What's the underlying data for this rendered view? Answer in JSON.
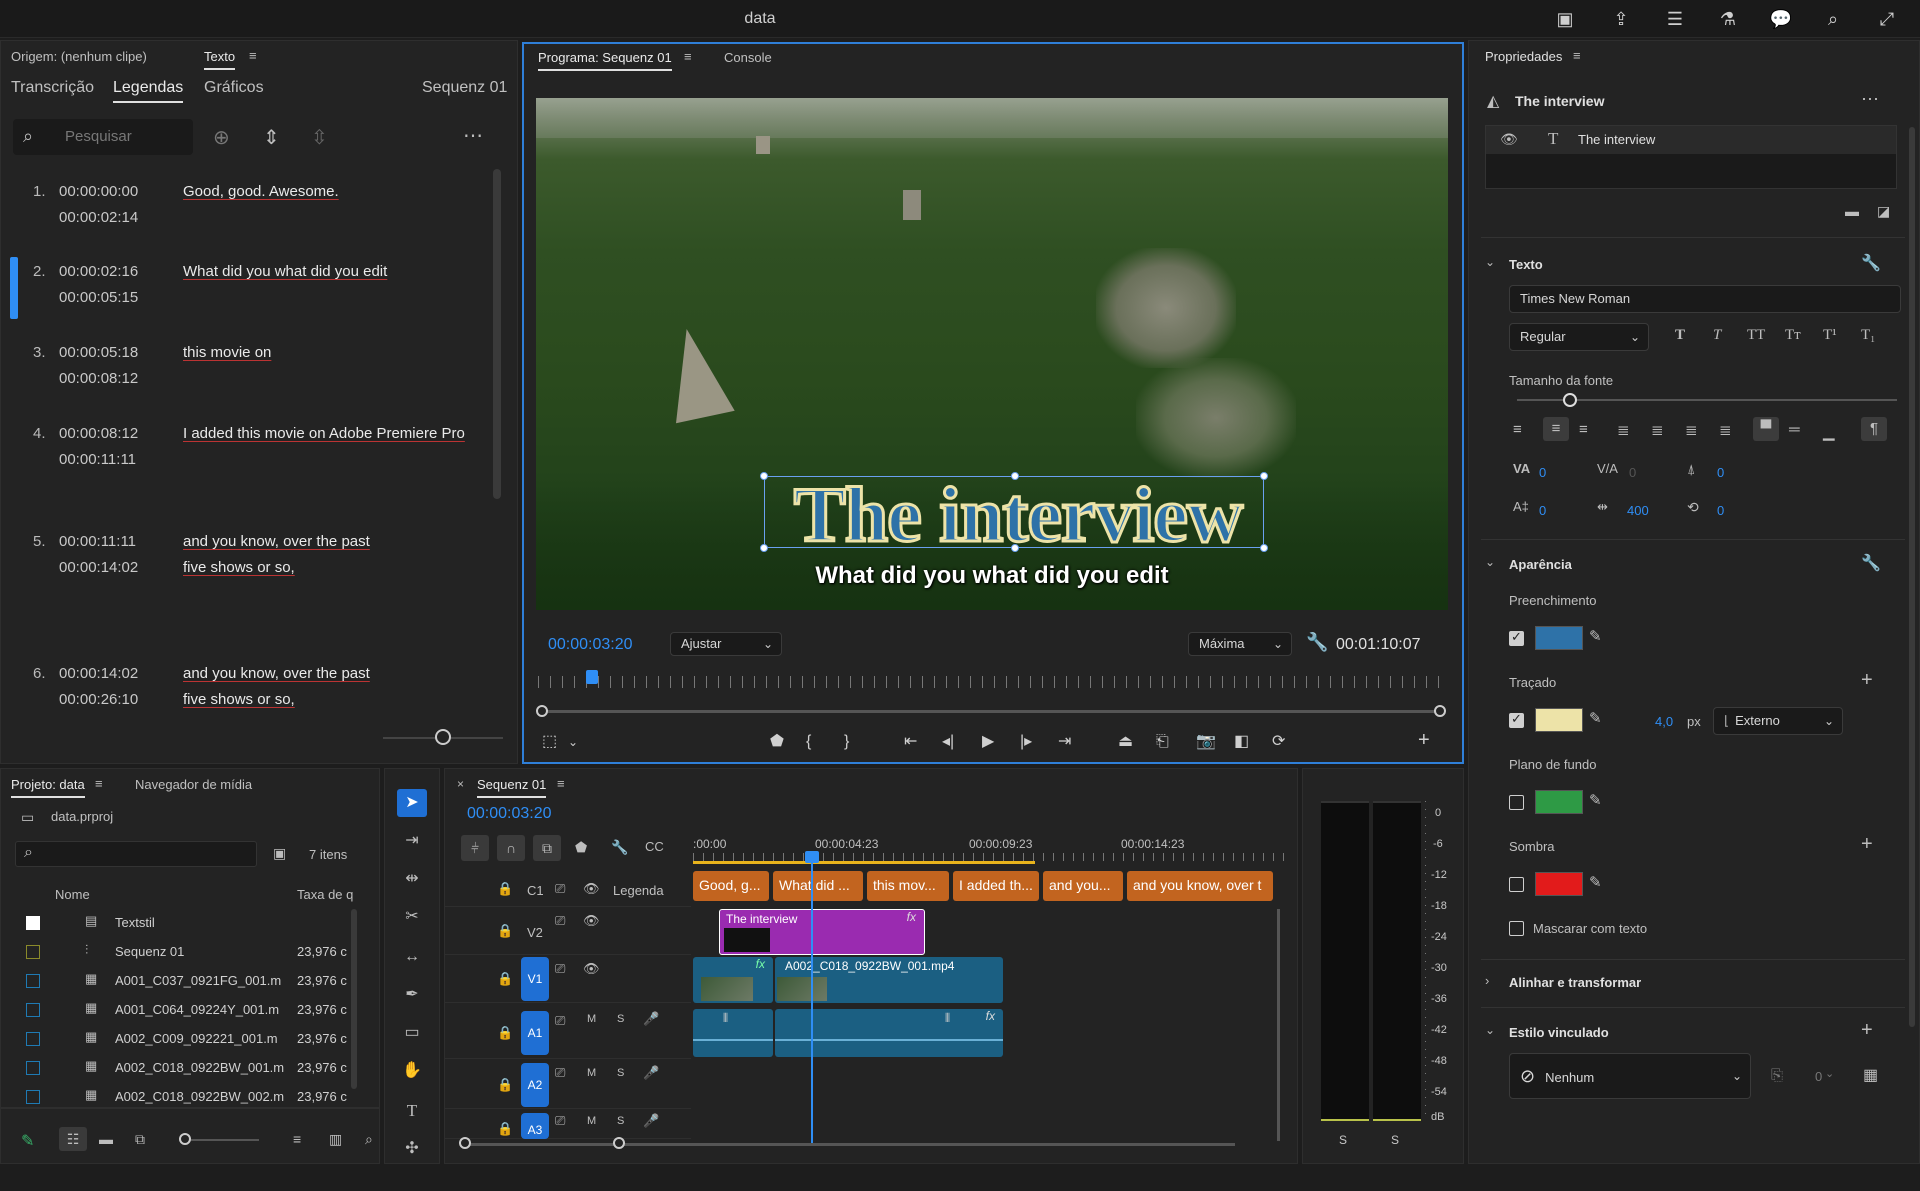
{
  "app": {
    "title": "data"
  },
  "colors": {
    "accent": "#2f8ef5",
    "caption_clip": "#c2641f",
    "graphic_clip": "#9a2bb0",
    "video_clip": "#1b5f82",
    "fill": "#2e72a8",
    "stroke": "#ede3a8",
    "background": "#2e9a45",
    "shadow": "#e21b1b"
  },
  "text_panel": {
    "origin": "Origem: (nenhum clipe)",
    "panel_tab": "Texto",
    "subtabs": [
      "Transcrição",
      "Legendas",
      "Gráficos"
    ],
    "sequence": "Sequenz 01",
    "search_placeholder": "Pesquisar",
    "captions": [
      {
        "n": "1.",
        "in": "00:00:00:00",
        "out": "00:00:02:14",
        "text": "Good, good. Awesome."
      },
      {
        "n": "2.",
        "in": "00:00:02:16",
        "out": "00:00:05:15",
        "text": "What did you what did you edit"
      },
      {
        "n": "3.",
        "in": "00:00:05:18",
        "out": "00:00:08:12",
        "text": "this movie on"
      },
      {
        "n": "4.",
        "in": "00:00:08:12",
        "out": "00:00:11:11",
        "text": "I added this movie on Adobe Premiere Pro"
      },
      {
        "n": "5.",
        "in": "00:00:11:11",
        "out": "00:00:14:02",
        "text": "and you know, over the past five shows or so,"
      },
      {
        "n": "6.",
        "in": "00:00:14:02",
        "out": "00:00:26:10",
        "text": "and you know, over the past five shows or so,"
      }
    ]
  },
  "program": {
    "tab": "Programa: Sequenz 01",
    "tab2": "Console",
    "title_text": "The interview",
    "subtitle_text": "What did you what did you edit",
    "timecode": "00:00:03:20",
    "fit": "Ajustar",
    "quality": "Máxima",
    "duration": "00:01:10:07",
    "playhead_fraction": 0.053
  },
  "properties": {
    "title": "Propriedades",
    "layer_name": "The interview",
    "layer_item": "The interview",
    "section_text": "Texto",
    "font": "Times New Roman",
    "style": "Regular",
    "font_size_label": "Tamanho da fonte",
    "font_size_slider": 0.14,
    "metrics": {
      "kerning": "0",
      "tracking": "0",
      "baseline": "0",
      "leading": "0",
      "tsume": "400",
      "rotation": "0"
    },
    "section_appearance": "Aparência",
    "fill_label": "Preenchimento",
    "stroke_label": "Traçado",
    "stroke_width": "4,0",
    "stroke_unit": "px",
    "stroke_pos": "Externo",
    "background_label": "Plano de fundo",
    "shadow_label": "Sombra",
    "mask_label": "Mascarar com texto",
    "align_label": "Alinhar e transformar",
    "linked_label": "Estilo vinculado",
    "linked_value": "Nenhum",
    "linked_count": "0"
  },
  "project": {
    "tab": "Projeto: data",
    "tab2": "Navegador de mídia",
    "file": "data.prproj",
    "count": "7 itens",
    "col_name": "Nome",
    "col_rate": "Taxa de q",
    "items": [
      {
        "name": "Textstil",
        "rate": ""
      },
      {
        "name": "Sequenz 01",
        "rate": "23,976 c"
      },
      {
        "name": "A001_C037_0921FG_001.m",
        "rate": "23,976 c"
      },
      {
        "name": "A001_C064_09224Y_001.m",
        "rate": "23,976 c"
      },
      {
        "name": "A002_C009_092221_001.m",
        "rate": "23,976 c"
      },
      {
        "name": "A002_C018_0922BW_001.m",
        "rate": "23,976 c"
      },
      {
        "name": "A002_C018_0922BW_002.m",
        "rate": "23,976 c"
      }
    ]
  },
  "timeline": {
    "tab": "Sequenz 01",
    "timecode": "00:00:03:20",
    "ruler": [
      ":00:00",
      "00:00:04:23",
      "00:00:09:23",
      "00:00:14:23"
    ],
    "tracks": {
      "c1": "C1",
      "caption_label": "Legenda",
      "v2": "V2",
      "v1": "V1",
      "a1": "A1",
      "a2": "A2",
      "a3": "A3",
      "m": "M",
      "s": "S"
    },
    "caption_clips": [
      "Good, g...",
      "What did ...",
      "this mov...",
      "I added th...",
      "and you...",
      "and you know, over t"
    ],
    "graphic_clip": "The interview",
    "video_clip": "A002_C018_0922BW_001.mp4"
  },
  "meter": {
    "scale": [
      "0",
      "-6",
      "-12",
      "-18",
      "-24",
      "-30",
      "-36",
      "-42",
      "-48",
      "-54",
      "dB"
    ],
    "channels": [
      "S",
      "S"
    ]
  }
}
